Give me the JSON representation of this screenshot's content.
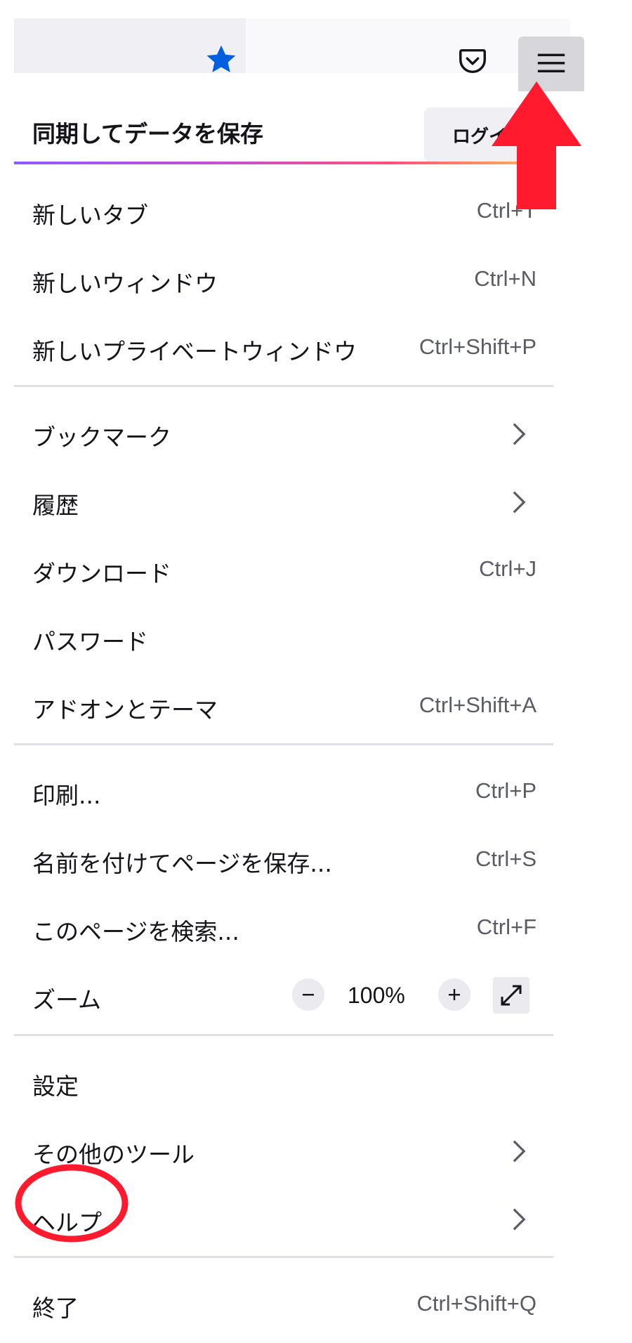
{
  "toolbar": {
    "bookmark_icon": "star-icon",
    "pocket_icon": "pocket-icon",
    "menu_icon": "hamburger-menu-icon",
    "accent_color": "#0060df"
  },
  "sync": {
    "label": "同期してデータを保存",
    "login_label": "ログイン"
  },
  "menu": {
    "new_tab": {
      "label": "新しいタブ",
      "shortcut": "Ctrl+T"
    },
    "new_window": {
      "label": "新しいウィンドウ",
      "shortcut": "Ctrl+N"
    },
    "new_private_window": {
      "label": "新しいプライベートウィンドウ",
      "shortcut": "Ctrl+Shift+P"
    },
    "bookmarks": {
      "label": "ブックマーク"
    },
    "history": {
      "label": "履歴"
    },
    "downloads": {
      "label": "ダウンロード",
      "shortcut": "Ctrl+J"
    },
    "passwords": {
      "label": "パスワード"
    },
    "addons": {
      "label": "アドオンとテーマ",
      "shortcut": "Ctrl+Shift+A"
    },
    "print": {
      "label": "印刷...",
      "shortcut": "Ctrl+P"
    },
    "save_page": {
      "label": "名前を付けてページを保存...",
      "shortcut": "Ctrl+S"
    },
    "find": {
      "label": "このページを検索...",
      "shortcut": "Ctrl+F"
    },
    "zoom": {
      "label": "ズーム",
      "value": "100%",
      "zoom_out_symbol": "−",
      "zoom_in_symbol": "+"
    },
    "settings": {
      "label": "設定"
    },
    "more_tools": {
      "label": "その他のツール"
    },
    "help": {
      "label": "ヘルプ"
    },
    "quit": {
      "label": "終了",
      "shortcut": "Ctrl+Shift+Q"
    }
  },
  "annotations": {
    "arrow_color": "#ff1a2e",
    "circle_color": "#ff1a2e"
  }
}
